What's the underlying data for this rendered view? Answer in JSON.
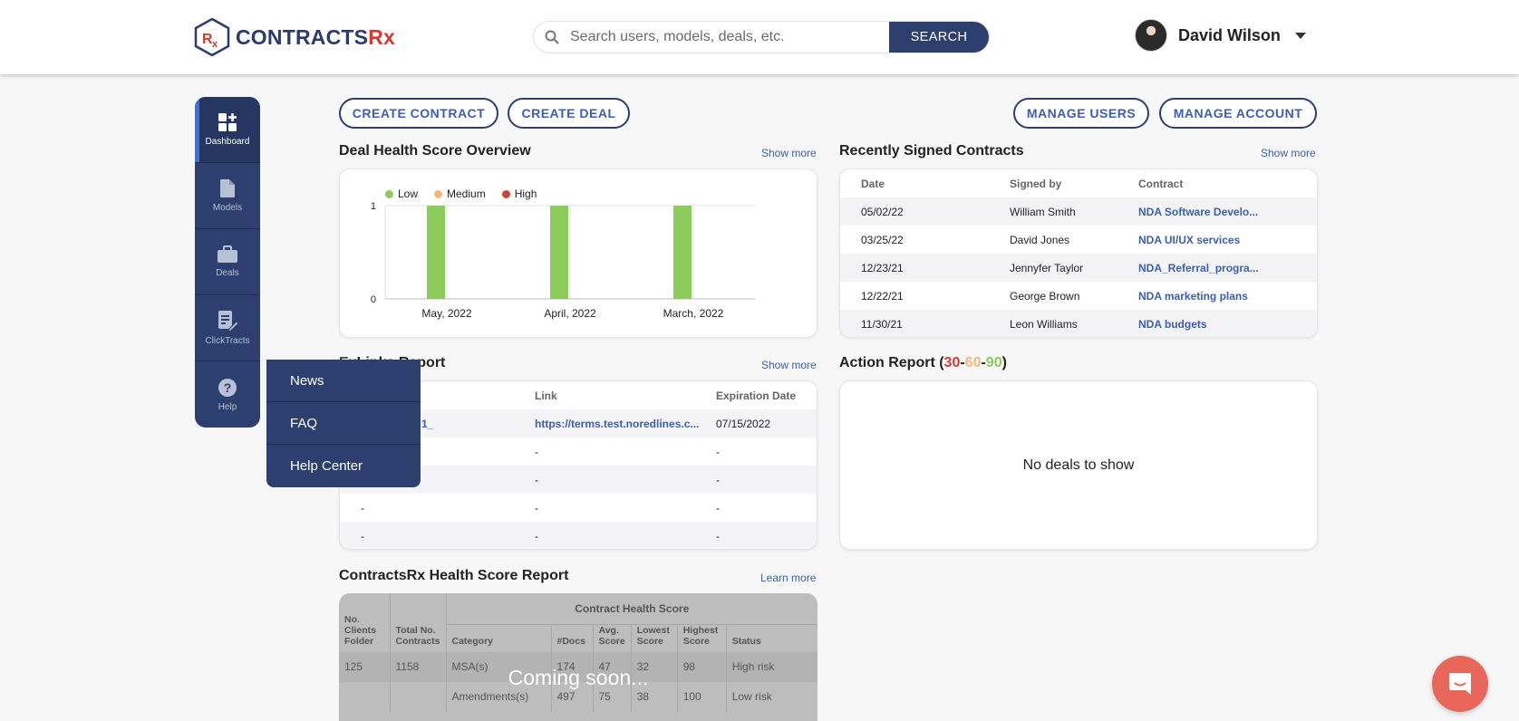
{
  "header": {
    "logo_text_a": "CONTRACTS",
    "logo_text_b": "Rx",
    "search_placeholder": "Search users, models, deals, etc.",
    "search_button": "SEARCH",
    "user_name": "David Wilson"
  },
  "sidebar": {
    "items": [
      {
        "label": "Dashboard",
        "icon": "dashboard-icon"
      },
      {
        "label": "Models",
        "icon": "document-icon"
      },
      {
        "label": "Deals",
        "icon": "briefcase-icon"
      },
      {
        "label": "ClickTracts",
        "icon": "sign-document-icon"
      },
      {
        "label": "Help",
        "icon": "help-icon"
      }
    ]
  },
  "help_menu": [
    "News",
    "FAQ",
    "Help Center"
  ],
  "actions": {
    "create_contract": "CREATE CONTRACT",
    "create_deal": "CREATE DEAL",
    "manage_users": "MANAGE USERS",
    "manage_account": "MANAGE ACCOUNT"
  },
  "deal_health": {
    "title": "Deal Health Score Overview",
    "show_more": "Show more",
    "chart_data": {
      "type": "bar",
      "categories": [
        "May, 2022",
        "April, 2022",
        "March, 2022"
      ],
      "series": [
        {
          "name": "Low",
          "values": [
            1,
            1,
            1
          ],
          "color": "#8ccc5a"
        },
        {
          "name": "Medium",
          "values": [
            0,
            0,
            0
          ],
          "color": "#f5b87a"
        },
        {
          "name": "High",
          "values": [
            0,
            0,
            0
          ],
          "color": "#c9463d"
        }
      ],
      "ylim": [
        0,
        1
      ],
      "yticks": [
        "1",
        "0"
      ],
      "legend": "top-left"
    }
  },
  "signed": {
    "title": "Recently Signed Contracts",
    "show_more": "Show more",
    "columns": [
      "Date",
      "Signed by",
      "Contract"
    ],
    "rows": [
      [
        "05/02/22",
        "William Smith",
        "NDA Software Develo..."
      ],
      [
        "03/25/22",
        "David Jones",
        "NDA UI/UX services"
      ],
      [
        "12/23/21",
        "Jennyfer Taylor",
        "NDA_Referral_progra..."
      ],
      [
        "12/22/21",
        "George Brown",
        "NDA marketing plans"
      ],
      [
        "11/30/21",
        "Leon Williams",
        "NDA budgets"
      ]
    ]
  },
  "links": {
    "title_visible": "Links Report",
    "show_more": "Show more",
    "columns": [
      "Link",
      "Expiration Date"
    ],
    "rows": [
      [
        "te 1_",
        "https://terms.test.noredlines.c...",
        "07/15/2022"
      ],
      [
        "",
        "-",
        "-"
      ],
      [
        "",
        "-",
        "-"
      ],
      [
        "-",
        "-",
        "-"
      ],
      [
        "-",
        "-",
        "-"
      ]
    ]
  },
  "action_report": {
    "title_prefix": "Action Report (",
    "n30": "30",
    "dash": "-",
    "n60": "60",
    "n90": "90",
    "title_suffix": ")",
    "empty": "No deals to show",
    "colors": {
      "n30": "#d23c34",
      "n60": "#f5b87a",
      "n90": "#8ccc5a"
    }
  },
  "health_report": {
    "title": "ContractsRx Health Score Report",
    "learn_more": "Learn more",
    "col_clients": "No. Clients Folder",
    "col_total": "Total No. Contracts",
    "group": "Contract Health Score",
    "columns": [
      "Category",
      "#Docs",
      "Avg. Score",
      "Lowest Score",
      "Highest Score",
      "Status"
    ],
    "rows": [
      [
        "125",
        "1158",
        "MSA(s)",
        "174",
        "47",
        "32",
        "98",
        "High risk"
      ],
      [
        "",
        "",
        "Amendments(s)",
        "497",
        "75",
        "38",
        "100",
        "Low risk"
      ]
    ],
    "overlay": "Coming soon..."
  }
}
